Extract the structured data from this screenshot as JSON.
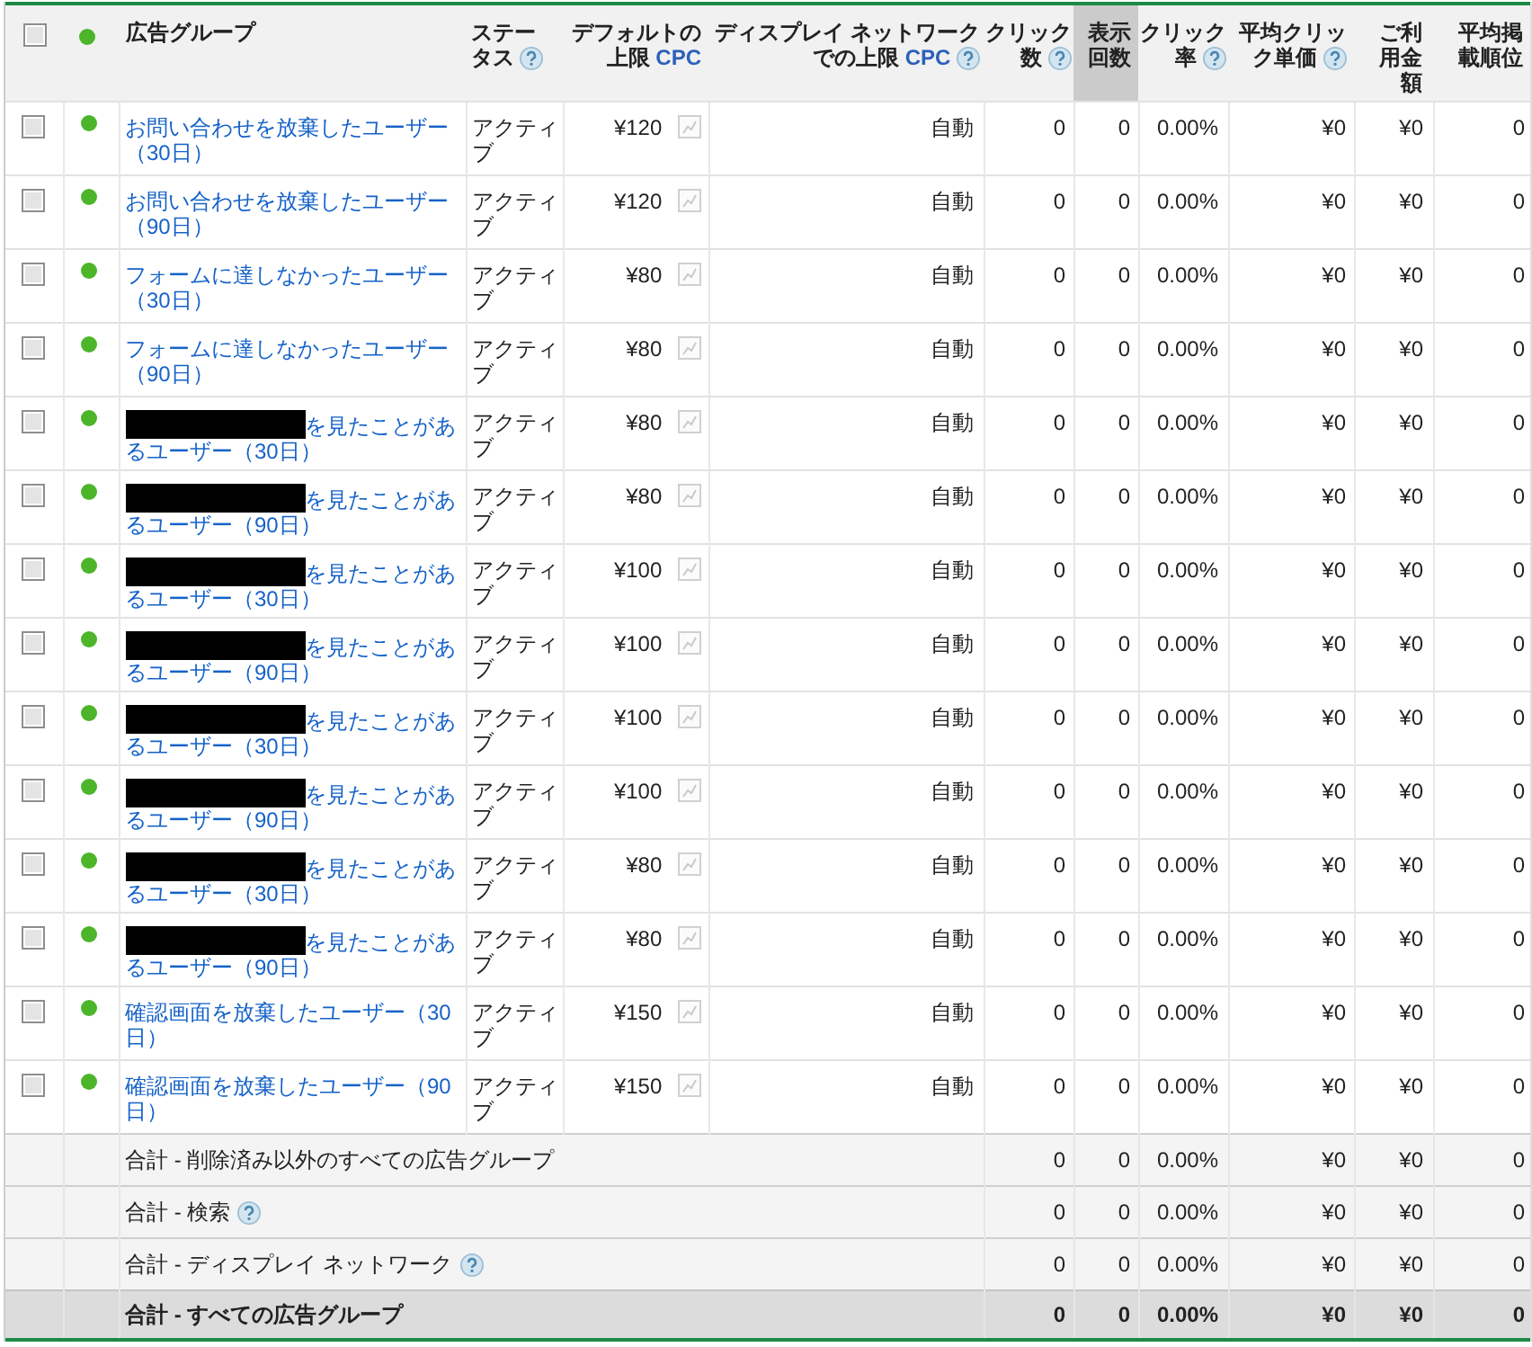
{
  "table": {
    "select_all": {
      "checked": false
    },
    "columns": [
      {
        "kind": "name",
        "label": "広告グループ",
        "help": false,
        "sorted": false
      },
      {
        "kind": "status",
        "label": "ステータス",
        "help": true,
        "sorted": false
      },
      {
        "kind": "bid",
        "label": "デフォルトの上限",
        "abbr": "CPC",
        "help": false,
        "sorted": false
      },
      {
        "kind": "bid",
        "label": "ディスプレイ ネットワークでの上限",
        "abbr": "CPC",
        "help": true,
        "sorted": false
      },
      {
        "kind": "metric",
        "label": "クリック数",
        "help": true,
        "sorted": false
      },
      {
        "kind": "metric",
        "label": "表示回数",
        "help": false,
        "sorted": true
      },
      {
        "kind": "metric",
        "label": "クリック率",
        "help": true,
        "sorted": false
      },
      {
        "kind": "metric",
        "label": "平均クリック単価",
        "help": true,
        "sorted": false
      },
      {
        "kind": "metric",
        "label": "ご利用金額",
        "help": false,
        "sorted": false
      },
      {
        "kind": "metric",
        "label": "平均掲載順位",
        "help": false,
        "sorted": false
      }
    ],
    "rows": [
      {
        "checked": false,
        "redacted": false,
        "name": "お問い合わせを放棄したユーザー（30日）",
        "status": "アクティブ",
        "default_cpc": "¥120",
        "display_cpc": "自動",
        "metrics": [
          "0",
          "0",
          "0.00%",
          "¥0",
          "¥0",
          "0"
        ]
      },
      {
        "checked": false,
        "redacted": false,
        "name": "お問い合わせを放棄したユーザー（90日）",
        "status": "アクティブ",
        "default_cpc": "¥120",
        "display_cpc": "自動",
        "metrics": [
          "0",
          "0",
          "0.00%",
          "¥0",
          "¥0",
          "0"
        ]
      },
      {
        "checked": false,
        "redacted": false,
        "name": "フォームに達しなかったユーザー（30日）",
        "status": "アクティブ",
        "default_cpc": "¥80",
        "display_cpc": "自動",
        "metrics": [
          "0",
          "0",
          "0.00%",
          "¥0",
          "¥0",
          "0"
        ]
      },
      {
        "checked": false,
        "redacted": false,
        "name": "フォームに達しなかったユーザー（90日）",
        "status": "アクティブ",
        "default_cpc": "¥80",
        "display_cpc": "自動",
        "metrics": [
          "0",
          "0",
          "0.00%",
          "¥0",
          "¥0",
          "0"
        ]
      },
      {
        "checked": false,
        "redacted": true,
        "name": "を見たことがあるユーザー（30日）",
        "status": "アクティブ",
        "default_cpc": "¥80",
        "display_cpc": "自動",
        "metrics": [
          "0",
          "0",
          "0.00%",
          "¥0",
          "¥0",
          "0"
        ]
      },
      {
        "checked": false,
        "redacted": true,
        "name": "を見たことがあるユーザー（90日）",
        "status": "アクティブ",
        "default_cpc": "¥80",
        "display_cpc": "自動",
        "metrics": [
          "0",
          "0",
          "0.00%",
          "¥0",
          "¥0",
          "0"
        ]
      },
      {
        "checked": false,
        "redacted": true,
        "name": "を見たことがあるユーザー（30日）",
        "status": "アクティブ",
        "default_cpc": "¥100",
        "display_cpc": "自動",
        "metrics": [
          "0",
          "0",
          "0.00%",
          "¥0",
          "¥0",
          "0"
        ]
      },
      {
        "checked": false,
        "redacted": true,
        "name": "を見たことがあるユーザー（90日）",
        "status": "アクティブ",
        "default_cpc": "¥100",
        "display_cpc": "自動",
        "metrics": [
          "0",
          "0",
          "0.00%",
          "¥0",
          "¥0",
          "0"
        ]
      },
      {
        "checked": false,
        "redacted": true,
        "name": "を見たことがあるユーザー（30日）",
        "status": "アクティブ",
        "default_cpc": "¥100",
        "display_cpc": "自動",
        "metrics": [
          "0",
          "0",
          "0.00%",
          "¥0",
          "¥0",
          "0"
        ]
      },
      {
        "checked": false,
        "redacted": true,
        "name": "を見たことがあるユーザー（90日）",
        "status": "アクティブ",
        "default_cpc": "¥100",
        "display_cpc": "自動",
        "metrics": [
          "0",
          "0",
          "0.00%",
          "¥0",
          "¥0",
          "0"
        ]
      },
      {
        "checked": false,
        "redacted": true,
        "name": "を見たことがあるユーザー（30日）",
        "status": "アクティブ",
        "default_cpc": "¥80",
        "display_cpc": "自動",
        "metrics": [
          "0",
          "0",
          "0.00%",
          "¥0",
          "¥0",
          "0"
        ]
      },
      {
        "checked": false,
        "redacted": true,
        "name": "を見たことがあるユーザー（90日）",
        "status": "アクティブ",
        "default_cpc": "¥80",
        "display_cpc": "自動",
        "metrics": [
          "0",
          "0",
          "0.00%",
          "¥0",
          "¥0",
          "0"
        ]
      },
      {
        "checked": false,
        "redacted": false,
        "name": "確認画面を放棄したユーザー（30日）",
        "status": "アクティブ",
        "default_cpc": "¥150",
        "display_cpc": "自動",
        "metrics": [
          "0",
          "0",
          "0.00%",
          "¥0",
          "¥0",
          "0"
        ]
      },
      {
        "checked": false,
        "redacted": false,
        "name": "確認画面を放棄したユーザー（90日）",
        "status": "アクティブ",
        "default_cpc": "¥150",
        "display_cpc": "自動",
        "metrics": [
          "0",
          "0",
          "0.00%",
          "¥0",
          "¥0",
          "0"
        ]
      }
    ],
    "totals": [
      {
        "kind": "subtotal",
        "label": "合計 - 削除済み以外のすべての広告グループ",
        "help": false,
        "metrics": [
          "0",
          "0",
          "0.00%",
          "¥0",
          "¥0",
          "0"
        ]
      },
      {
        "kind": "subtotal",
        "label": "合計 - 検索",
        "help": true,
        "metrics": [
          "0",
          "0",
          "0.00%",
          "¥0",
          "¥0",
          "0"
        ]
      },
      {
        "kind": "subtotal",
        "label": "合計 - ディスプレイ ネットワーク",
        "help": true,
        "metrics": [
          "0",
          "0",
          "0.00%",
          "¥0",
          "¥0",
          "0"
        ]
      },
      {
        "kind": "total",
        "label": "合計 - すべての広告グループ",
        "help": false,
        "metrics": [
          "0",
          "0",
          "0.00%",
          "¥0",
          "¥0",
          "0"
        ]
      }
    ]
  }
}
